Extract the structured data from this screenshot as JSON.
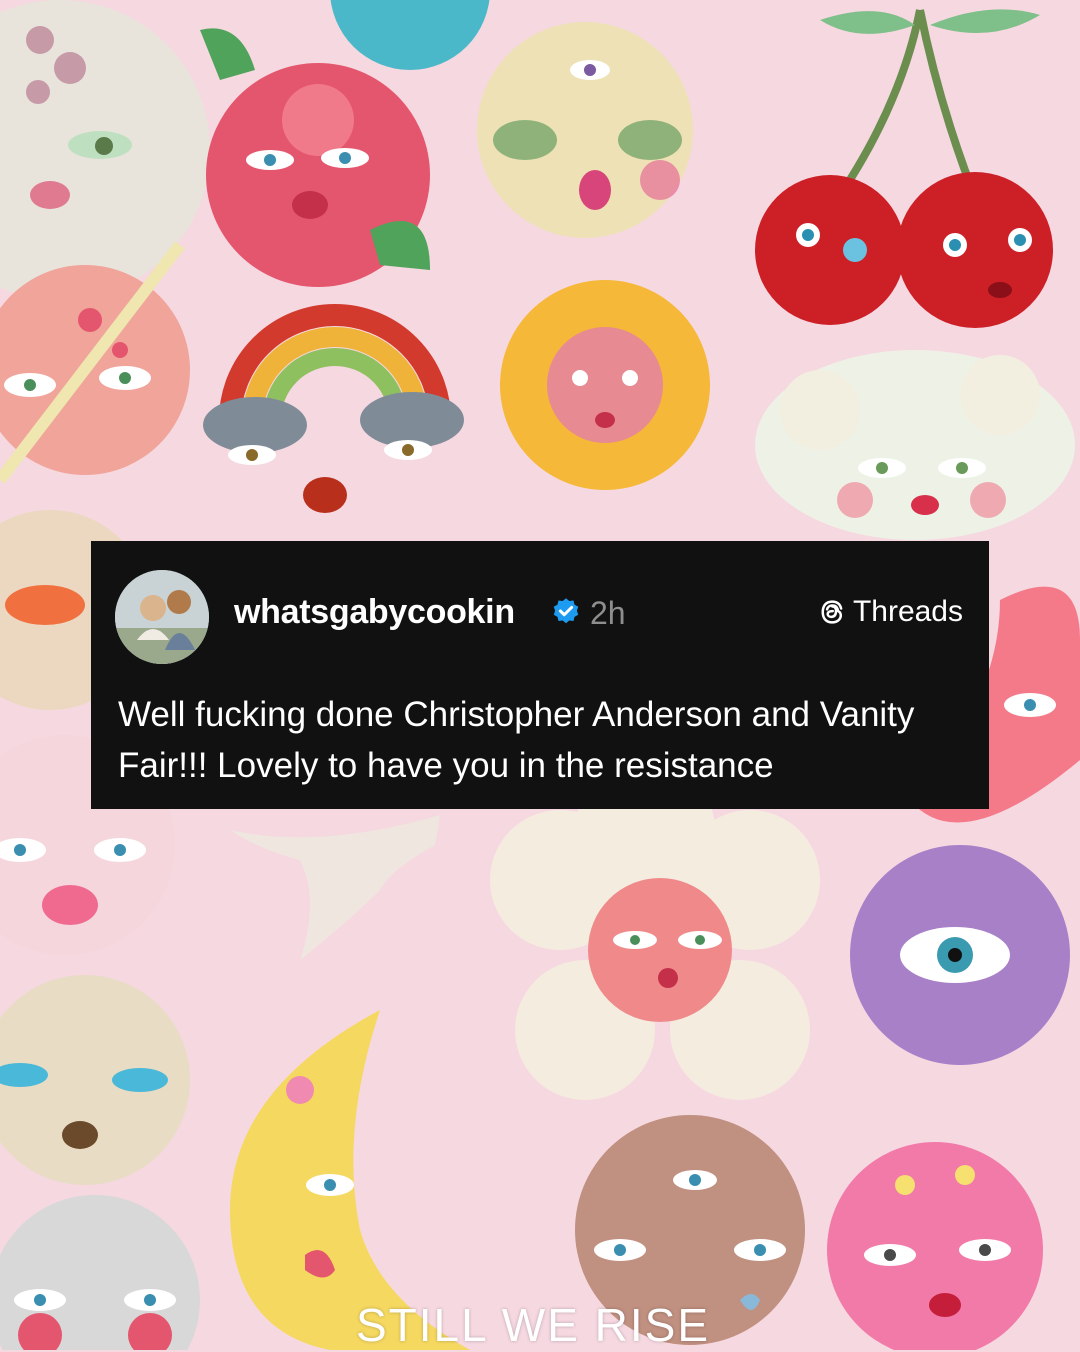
{
  "post": {
    "username": "whatsgabycookin",
    "time": "2h",
    "platform_label": "Threads",
    "text": "Well fucking done Christopher Anderson and Vanity Fair!!! Lovely to have you in the resistance",
    "verified_icon": "verified-badge-icon",
    "platform_icon": "threads-logo-icon"
  },
  "overlay": {
    "caption": "STILL WE RISE"
  },
  "colors": {
    "background": "#f6d8e0",
    "card": "#111111",
    "verified": "#1d9bf0",
    "muted_text": "#8e8e8e"
  }
}
